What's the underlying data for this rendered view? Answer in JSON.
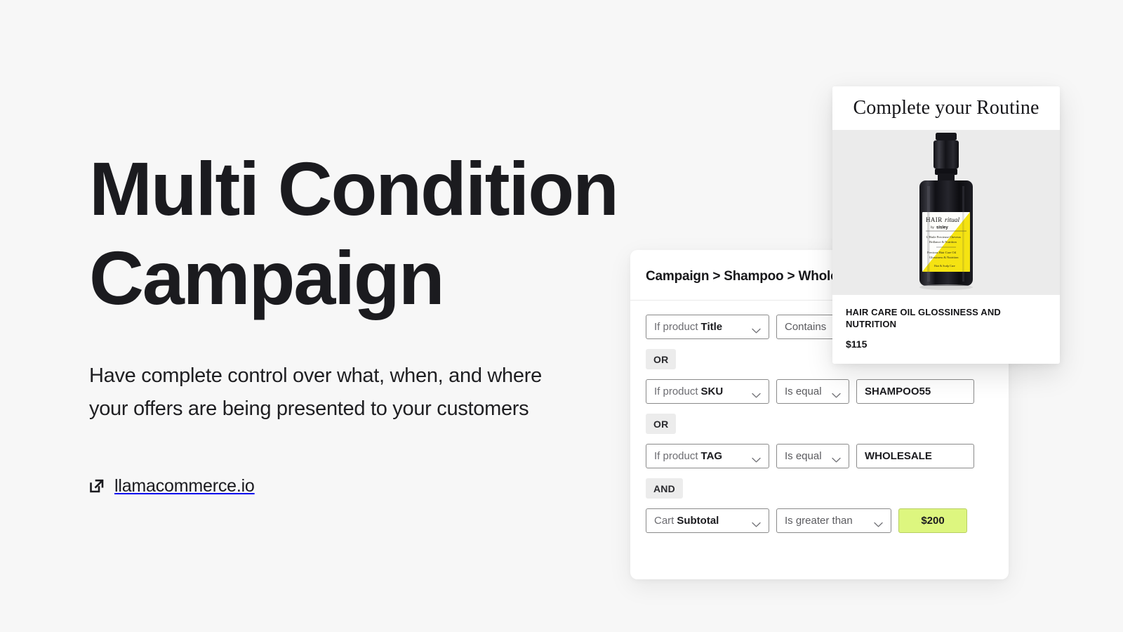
{
  "page": {
    "background_color": "#f7f7f7"
  },
  "hero": {
    "title": "Multi Condition\nCampaign",
    "subtitle": "Have complete control over what, when, and where your offers are being presented to your customers",
    "link_label": "llamacommerce.io",
    "link_icon": "external-link-icon"
  },
  "campaign": {
    "breadcrumb": "Campaign > Shampoo > Wholesale",
    "accent_color": "#ddf67f",
    "rows": [
      {
        "subject_prefix": "If product",
        "subject_value": "Title",
        "operator": "Contains",
        "value": "",
        "value_kind": "text",
        "logic_after": "OR"
      },
      {
        "subject_prefix": "If product",
        "subject_value": "SKU",
        "operator": "Is equal",
        "value": "SHAMPOO55",
        "value_kind": "text",
        "logic_after": "OR"
      },
      {
        "subject_prefix": "If product",
        "subject_value": "TAG",
        "operator": "Is equal",
        "value": "WHOLESALE",
        "value_kind": "text",
        "logic_after": "AND"
      },
      {
        "subject_prefix": "Cart",
        "subject_value": "Subtotal",
        "operator": "Is greater than",
        "value": "$200",
        "value_kind": "highlight",
        "logic_after": ""
      }
    ]
  },
  "product": {
    "header_title": "Complete your Routine",
    "name": "HAIR CARE OIL GLOSSINESS AND NUTRITION",
    "price": "$115",
    "image_alt": "hair-oil-bottle",
    "label_brand": "HAIR ritual",
    "label_sub": "by sisley"
  }
}
